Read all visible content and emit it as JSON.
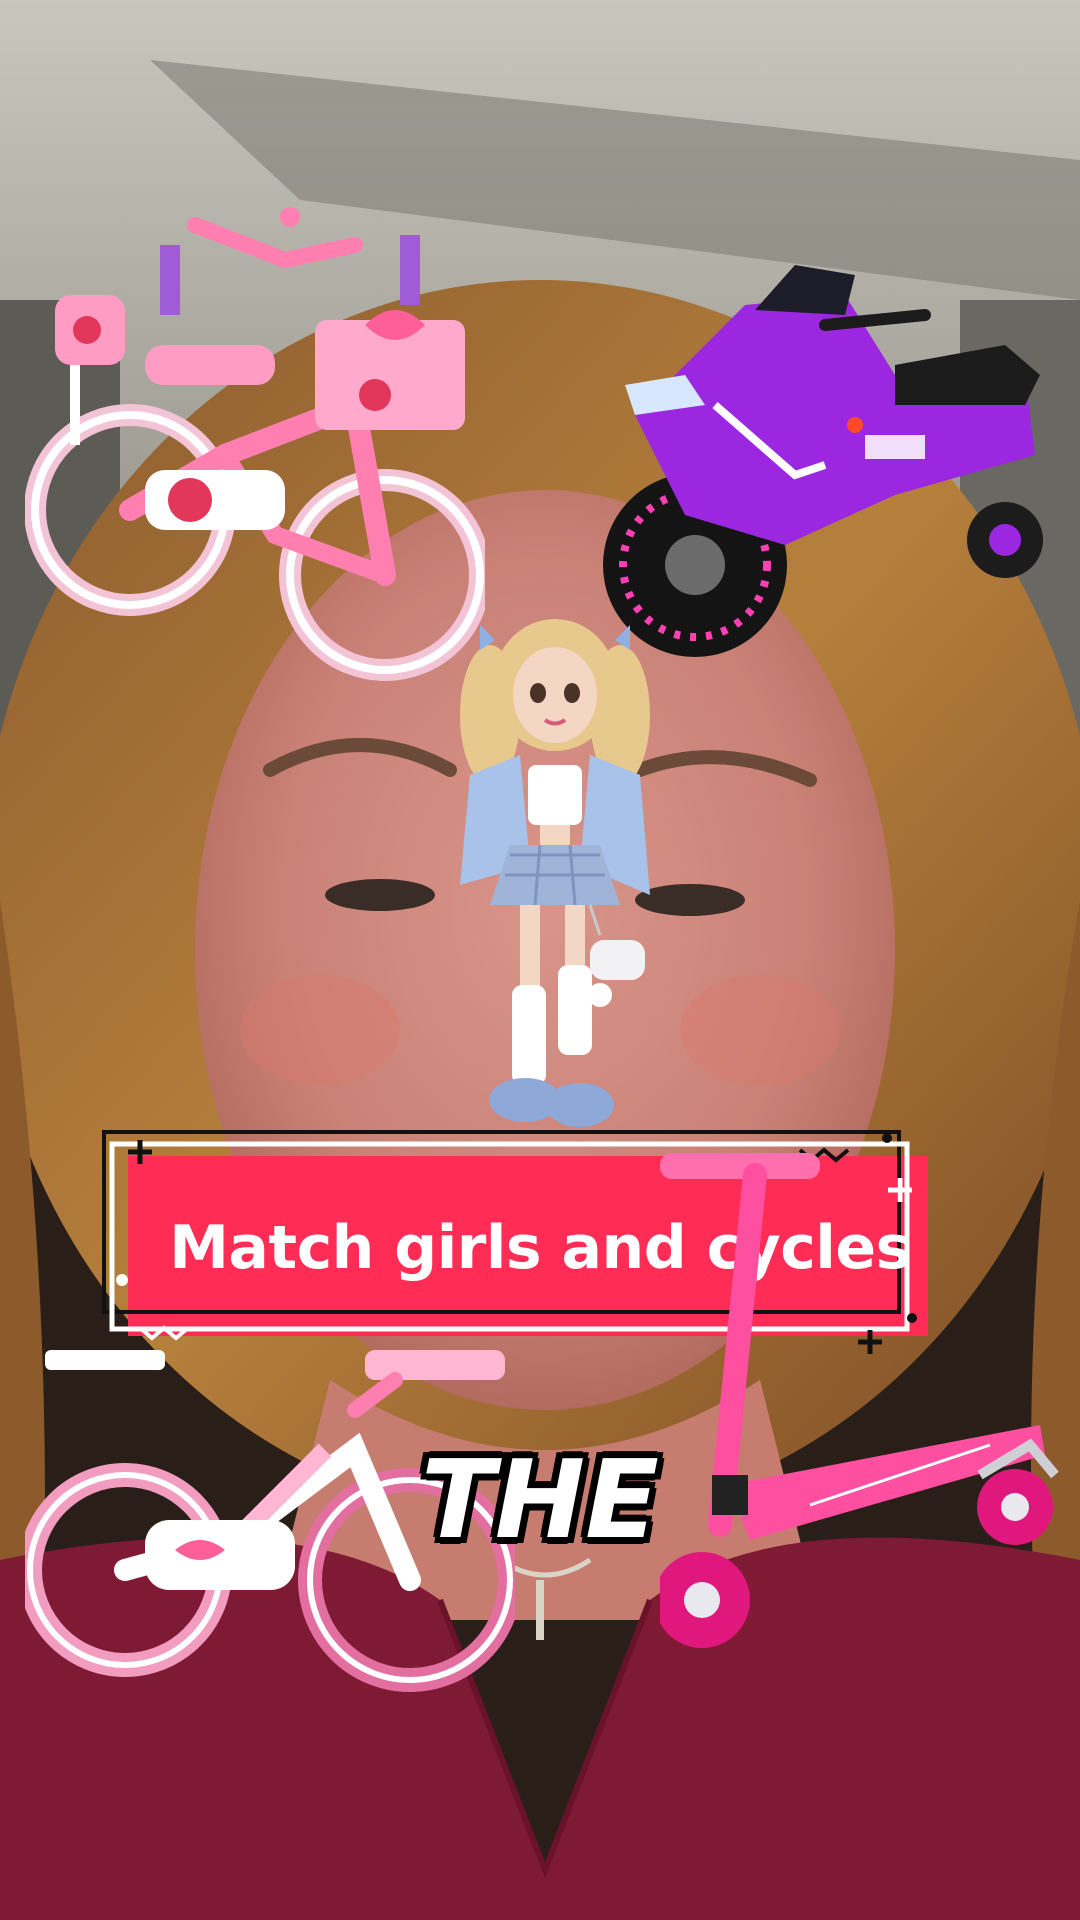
{
  "overlay": {
    "title": "Match girls and cycles",
    "caption_word": "THE"
  },
  "stickers": {
    "bike_top": "pink-strawberry-bicycle-icon",
    "motorcycle": "purple-ride-on-motorcycle-icon",
    "girl": "doll-girl-icon",
    "bike_bottom": "pink-bow-bicycle-icon",
    "scooter": "pink-kick-scooter-icon"
  },
  "colors": {
    "banner_red": "#ff2d55",
    "banner_frame": "#ffffff",
    "accent_pink": "#ff4fa0",
    "accent_purple": "#9b27e0"
  }
}
